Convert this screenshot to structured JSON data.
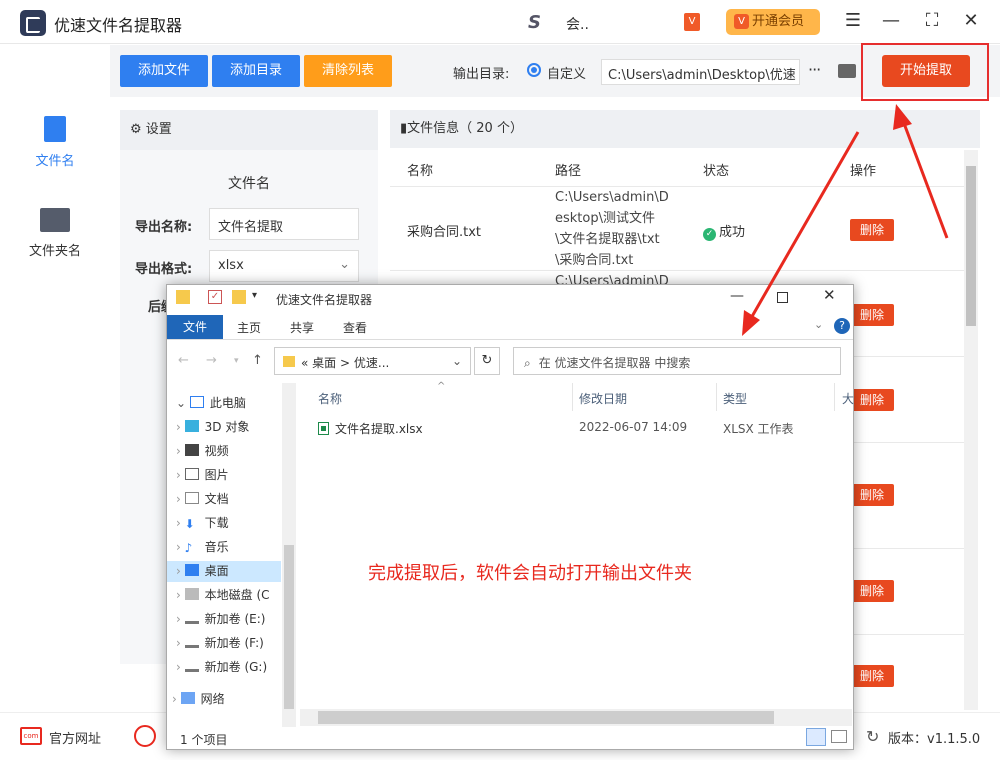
{
  "app": {
    "title": "优速文件名提取器",
    "user_name": "会..",
    "vip_label": "开通会员"
  },
  "sidebar": {
    "items": [
      {
        "label": "文件名"
      },
      {
        "label": "文件夹名"
      }
    ]
  },
  "toolbar": {
    "add_file": "添加文件",
    "add_dir": "添加目录",
    "clear_list": "清除列表",
    "output_label": "输出目录:",
    "radio_label": "自定义",
    "output_path": "C:\\Users\\admin\\Desktop\\优速",
    "start": "开始提取"
  },
  "settings": {
    "title": "设置",
    "subtitle": "文件名",
    "export_name_label": "导出名称:",
    "export_name_value": "文件名提取",
    "export_format_label": "导出格式:",
    "export_format_value": "xlsx",
    "suffix_label": "后缀"
  },
  "info": {
    "title": "文件信息（ 20 个）",
    "headers": [
      "名称",
      "路径",
      "状态",
      "操作"
    ],
    "row1": {
      "name": "采购合同.txt",
      "path": [
        "C:\\Users\\admin\\D",
        "esktop\\测试文件",
        "\\文件名提取器\\txt",
        "\\采购合同.txt"
      ],
      "status": "成功"
    },
    "row2_path_partial": "C:\\Users\\admin\\D",
    "delete_label": "删除"
  },
  "bottom": {
    "website": "官方网址",
    "version": "版本：v1.1.5.0"
  },
  "explorer": {
    "title": "优速文件名提取器",
    "tabs": [
      "文件",
      "主页",
      "共享",
      "查看"
    ],
    "address": [
      "«",
      "桌面",
      ">",
      "优速..."
    ],
    "search_placeholder": "在 优速文件名提取器 中搜索",
    "tree": [
      "此电脑",
      "3D 对象",
      "视频",
      "图片",
      "文档",
      "下载",
      "音乐",
      "桌面",
      "本地磁盘 (C",
      "新加卷 (E:)",
      "新加卷 (F:)",
      "新加卷 (G:)",
      "网络"
    ],
    "columns": [
      "名称",
      "修改日期",
      "类型",
      "大"
    ],
    "file": {
      "name": "文件名提取.xlsx",
      "date": "2022-06-07 14:09",
      "type": "XLSX 工作表"
    },
    "status": "1 个项目"
  },
  "annotation": "完成提取后，软件会自动打开输出文件夹",
  "colors": {
    "blue": "#2f7ff0",
    "orange": "#ff9d1a",
    "red": "#e8491f"
  }
}
